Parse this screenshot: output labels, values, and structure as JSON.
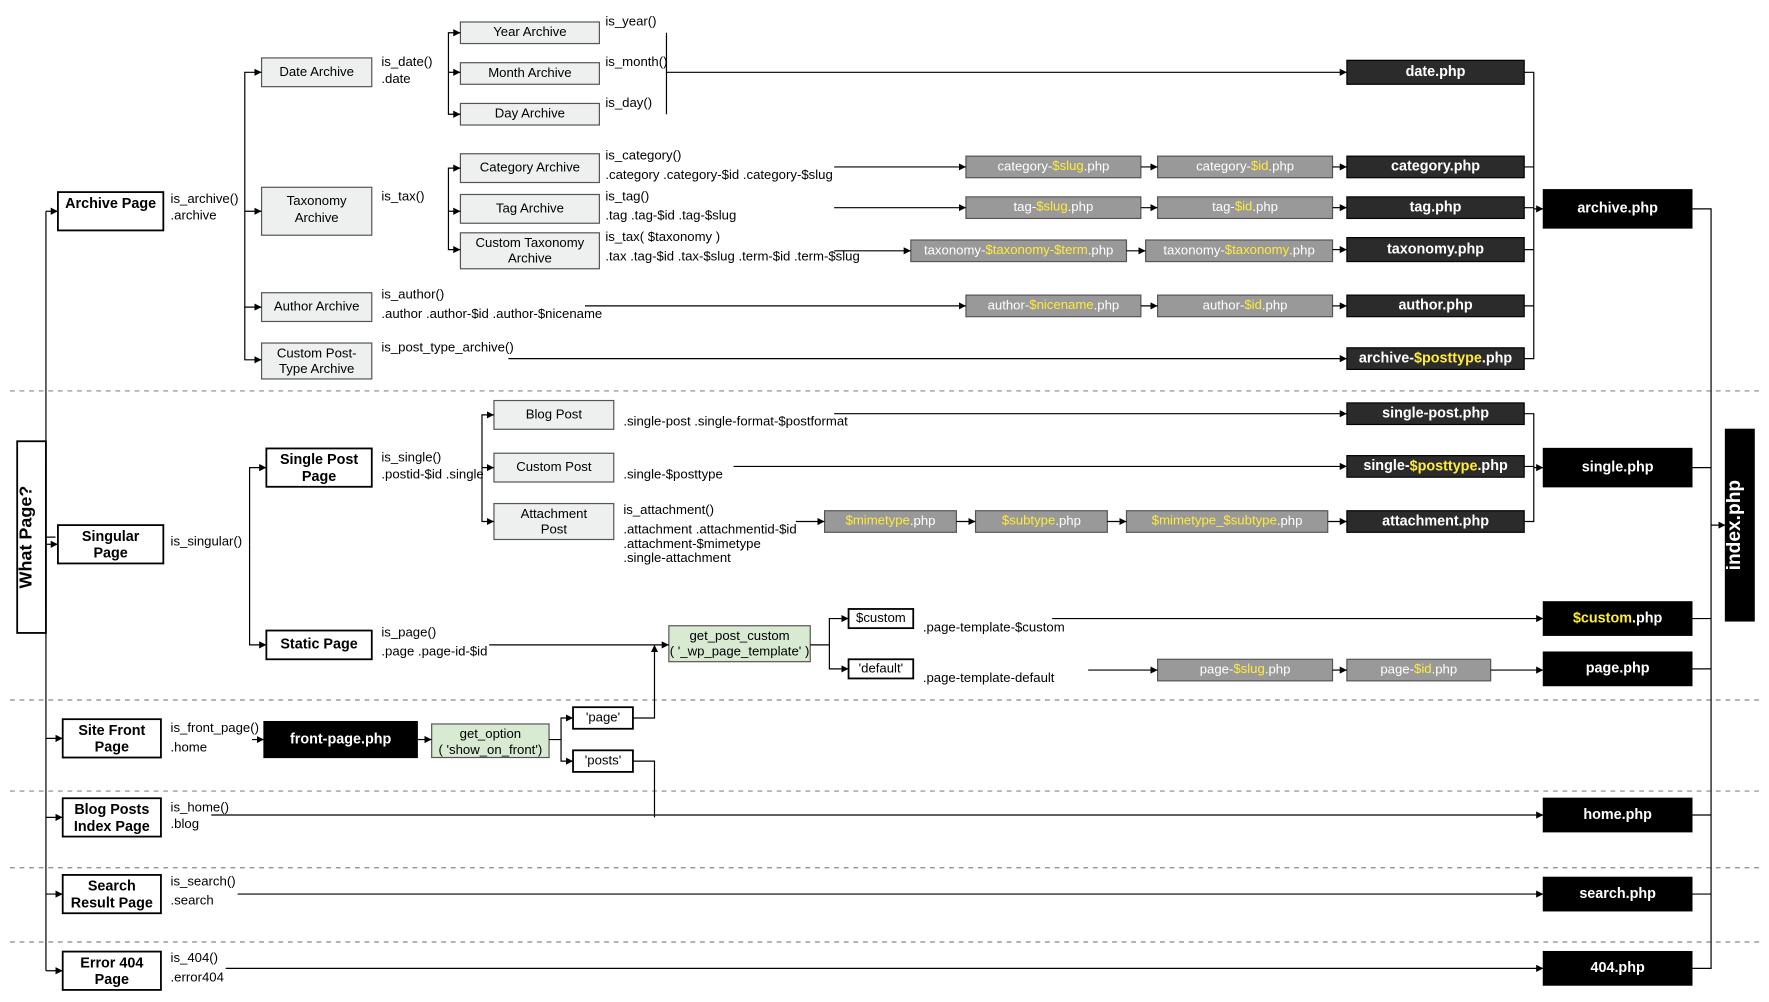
{
  "root": "What Page?",
  "final": "index.php",
  "archive": {
    "label": "Archive Page",
    "fn": "is_archive()",
    "cls": ".archive",
    "children": {
      "date": {
        "label": "Date Archive",
        "fn": "is_date()",
        "cls": ".date",
        "target": "date.php",
        "items": [
          {
            "label": "Year Archive",
            "fn": "is_year()"
          },
          {
            "label": "Month Archive",
            "fn": "is_month()"
          },
          {
            "label": "Day Archive",
            "fn": "is_day()"
          }
        ]
      },
      "tax": {
        "label": "Taxonomy Archive",
        "fn": "is_tax()",
        "items": [
          {
            "label": "Category Archive",
            "fn": "is_category()",
            "cls": ".category .category-$id .category-$slug",
            "g1": "category-$slug.php",
            "g2": "category-$id.php",
            "target": "category.php"
          },
          {
            "label": "Tag Archive",
            "fn": "is_tag()",
            "cls": ".tag .tag-$id .tag-$slug",
            "g1": "tag-$slug.php",
            "g2": "tag-$id.php",
            "target": "tag.php"
          },
          {
            "label": "Custom Taxonomy Archive",
            "fn": "is_tax( $taxonomy )",
            "cls": ".tax .tag-$id .tax-$slug .term-$id .term-$slug",
            "g1": "taxonomy-$taxonomy-$term.php",
            "g2": "taxonomy-$taxonomy.php",
            "target": "taxonomy.php"
          }
        ],
        "target": "archive.php"
      },
      "author": {
        "label": "Author Archive",
        "fn": "is_author()",
        "cls": ".author .author-$id .author-$nicename",
        "g1": "author-$nicename.php",
        "g2": "author-$id.php",
        "target": "author.php"
      },
      "cpt": {
        "label": "Custom Post-Type Archive",
        "fn": "is_post_type_archive()",
        "target": "archive-$posttype.php"
      }
    }
  },
  "singular": {
    "label": "Singular Page",
    "fn": "is_singular()",
    "children": {
      "single": {
        "label": "Single Post Page",
        "fn": "is_single()",
        "cls": ".postid-$id .single",
        "target": "single.php",
        "items": [
          {
            "label": "Blog Post",
            "cls": ".single-post .single-format-$postformat",
            "target": "single-post.php"
          },
          {
            "label": "Custom Post",
            "cls": ".single-$posttype",
            "target": "single-$posttype.php"
          },
          {
            "label": "Attachment Post",
            "fn": "is_attachment()",
            "cls": ".attachment .attachmentid-$id .attachment-$mimetype .single-attachment",
            "g1": "$mimetype.php",
            "g2": "$subtype.php",
            "g3": "$mimetype_$subtype.php",
            "target": "attachment.php"
          }
        ]
      },
      "static": {
        "label": "Static Page",
        "fn": "is_page()",
        "cls": ".page .page-id-$id",
        "get": "get_post_custom ( '_wp_page_template' )",
        "opt1": "$custom",
        "opt1cls": ".page-template-$custom",
        "opt1target": "$custom.php",
        "opt2": "'default'",
        "opt2cls": ".page-template-default",
        "g1": "page-$slug.php",
        "g2": "page-$id.php",
        "target": "page.php"
      }
    }
  },
  "front": {
    "label": "Site Front Page",
    "fn": "is_front_page()",
    "cls": ".home",
    "target": "front-page.php",
    "get": "get_option ( 'show_on_front')",
    "opt1": "'page'",
    "opt2": "'posts'"
  },
  "home": {
    "label": "Blog Posts Index Page",
    "fn": "is_home()",
    "cls": ".blog",
    "target": "home.php"
  },
  "search": {
    "label": "Search Result Page",
    "fn": "is_search()",
    "cls": ".search",
    "target": "search.php"
  },
  "err": {
    "label": "Error 404 Page",
    "fn": "is_404()",
    "cls": ".error404",
    "target": "404.php"
  }
}
